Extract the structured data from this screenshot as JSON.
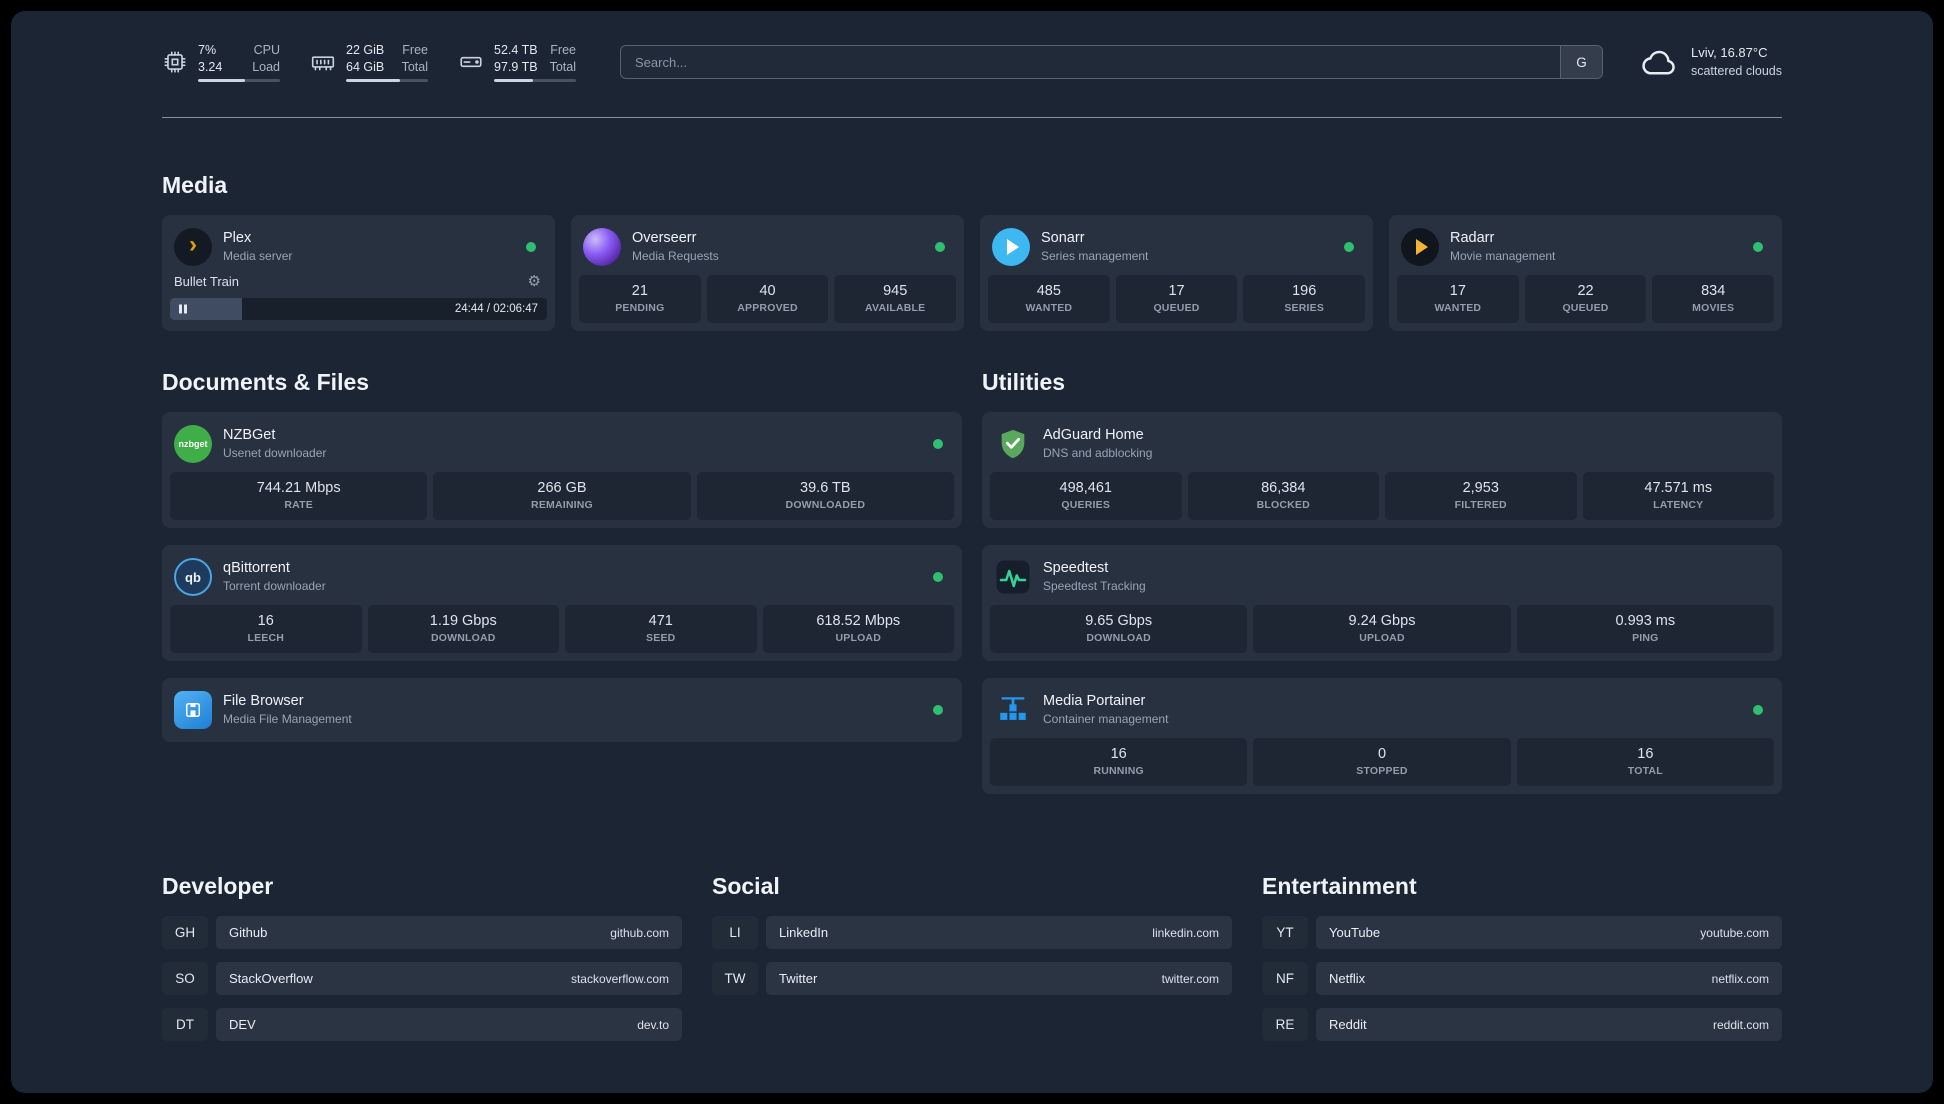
{
  "colors": {
    "background": "#1c2533",
    "card": "#273140",
    "stat_block": "#1d2632",
    "status_online": "#2fbf71",
    "plex_accent": "#e5a00d",
    "radarr_accent": "#f7b234",
    "sonarr_accent": "#3db8f0",
    "adguard_green": "#5aa75e",
    "speedtest_green": "#34d399",
    "portainer_blue": "#2496ed"
  },
  "topbar": {
    "cpu": {
      "value1": "7%",
      "label1": "CPU",
      "value2": "3.24",
      "label2": "Load",
      "bar": 57
    },
    "memory": {
      "value1": "22 GiB",
      "label1": "Free",
      "value2": "64 GiB",
      "label2": "Total",
      "bar": 66
    },
    "disk": {
      "value1": "52.4 TB",
      "label1": "Free",
      "value2": "97.9 TB",
      "label2": "Total",
      "bar": 47
    },
    "search": {
      "placeholder": "Search...",
      "button": "G"
    },
    "weather": {
      "location": "Lviv, 16.87°C",
      "condition": "scattered clouds"
    }
  },
  "sections": {
    "media": "Media",
    "documents": "Documents & Files",
    "utilities": "Utilities",
    "developer": "Developer",
    "social": "Social",
    "entertainment": "Entertainment"
  },
  "icon_text": {
    "plex": "›",
    "nzbget": "nzbget",
    "qbittorrent": "qb",
    "gear": "⚙"
  },
  "services": {
    "plex": {
      "name": "Plex",
      "desc": "Media server",
      "now_playing": "Bullet Train",
      "time": "24:44 / 02:06:47",
      "progress": 19
    },
    "overseerr": {
      "name": "Overseerr",
      "desc": "Media Requests",
      "stats": [
        {
          "value": "21",
          "label": "PENDING"
        },
        {
          "value": "40",
          "label": "APPROVED"
        },
        {
          "value": "945",
          "label": "AVAILABLE"
        }
      ]
    },
    "sonarr": {
      "name": "Sonarr",
      "desc": "Series management",
      "stats": [
        {
          "value": "485",
          "label": "WANTED"
        },
        {
          "value": "17",
          "label": "QUEUED"
        },
        {
          "value": "196",
          "label": "SERIES"
        }
      ]
    },
    "radarr": {
      "name": "Radarr",
      "desc": "Movie management",
      "stats": [
        {
          "value": "17",
          "label": "WANTED"
        },
        {
          "value": "22",
          "label": "QUEUED"
        },
        {
          "value": "834",
          "label": "MOVIES"
        }
      ]
    },
    "nzbget": {
      "name": "NZBGet",
      "desc": "Usenet downloader",
      "stats": [
        {
          "value": "744.21 Mbps",
          "label": "RATE"
        },
        {
          "value": "266 GB",
          "label": "REMAINING"
        },
        {
          "value": "39.6 TB",
          "label": "DOWNLOADED"
        }
      ]
    },
    "qbittorrent": {
      "name": "qBittorrent",
      "desc": "Torrent downloader",
      "stats": [
        {
          "value": "16",
          "label": "LEECH"
        },
        {
          "value": "1.19 Gbps",
          "label": "DOWNLOAD"
        },
        {
          "value": "471",
          "label": "SEED"
        },
        {
          "value": "618.52 Mbps",
          "label": "UPLOAD"
        }
      ]
    },
    "filebrowser": {
      "name": "File Browser",
      "desc": "Media File Management"
    },
    "adguard": {
      "name": "AdGuard Home",
      "desc": "DNS and adblocking",
      "stats": [
        {
          "value": "498,461",
          "label": "QUERIES"
        },
        {
          "value": "86,384",
          "label": "BLOCKED"
        },
        {
          "value": "2,953",
          "label": "FILTERED"
        },
        {
          "value": "47.571 ms",
          "label": "LATENCY"
        }
      ]
    },
    "speedtest": {
      "name": "Speedtest",
      "desc": "Speedtest Tracking",
      "stats": [
        {
          "value": "9.65 Gbps",
          "label": "DOWNLOAD"
        },
        {
          "value": "9.24 Gbps",
          "label": "UPLOAD"
        },
        {
          "value": "0.993 ms",
          "label": "PING"
        }
      ]
    },
    "portainer": {
      "name": "Media Portainer",
      "desc": "Container management",
      "stats": [
        {
          "value": "16",
          "label": "RUNNING"
        },
        {
          "value": "0",
          "label": "STOPPED"
        },
        {
          "value": "16",
          "label": "TOTAL"
        }
      ]
    }
  },
  "bookmarks": {
    "developer": [
      {
        "abbr": "GH",
        "name": "Github",
        "url": "github.com"
      },
      {
        "abbr": "SO",
        "name": "StackOverflow",
        "url": "stackoverflow.com"
      },
      {
        "abbr": "DT",
        "name": "DEV",
        "url": "dev.to"
      }
    ],
    "social": [
      {
        "abbr": "LI",
        "name": "LinkedIn",
        "url": "linkedin.com"
      },
      {
        "abbr": "TW",
        "name": "Twitter",
        "url": "twitter.com"
      }
    ],
    "entertainment": [
      {
        "abbr": "YT",
        "name": "YouTube",
        "url": "youtube.com"
      },
      {
        "abbr": "NF",
        "name": "Netflix",
        "url": "netflix.com"
      },
      {
        "abbr": "RE",
        "name": "Reddit",
        "url": "reddit.com"
      }
    ]
  }
}
